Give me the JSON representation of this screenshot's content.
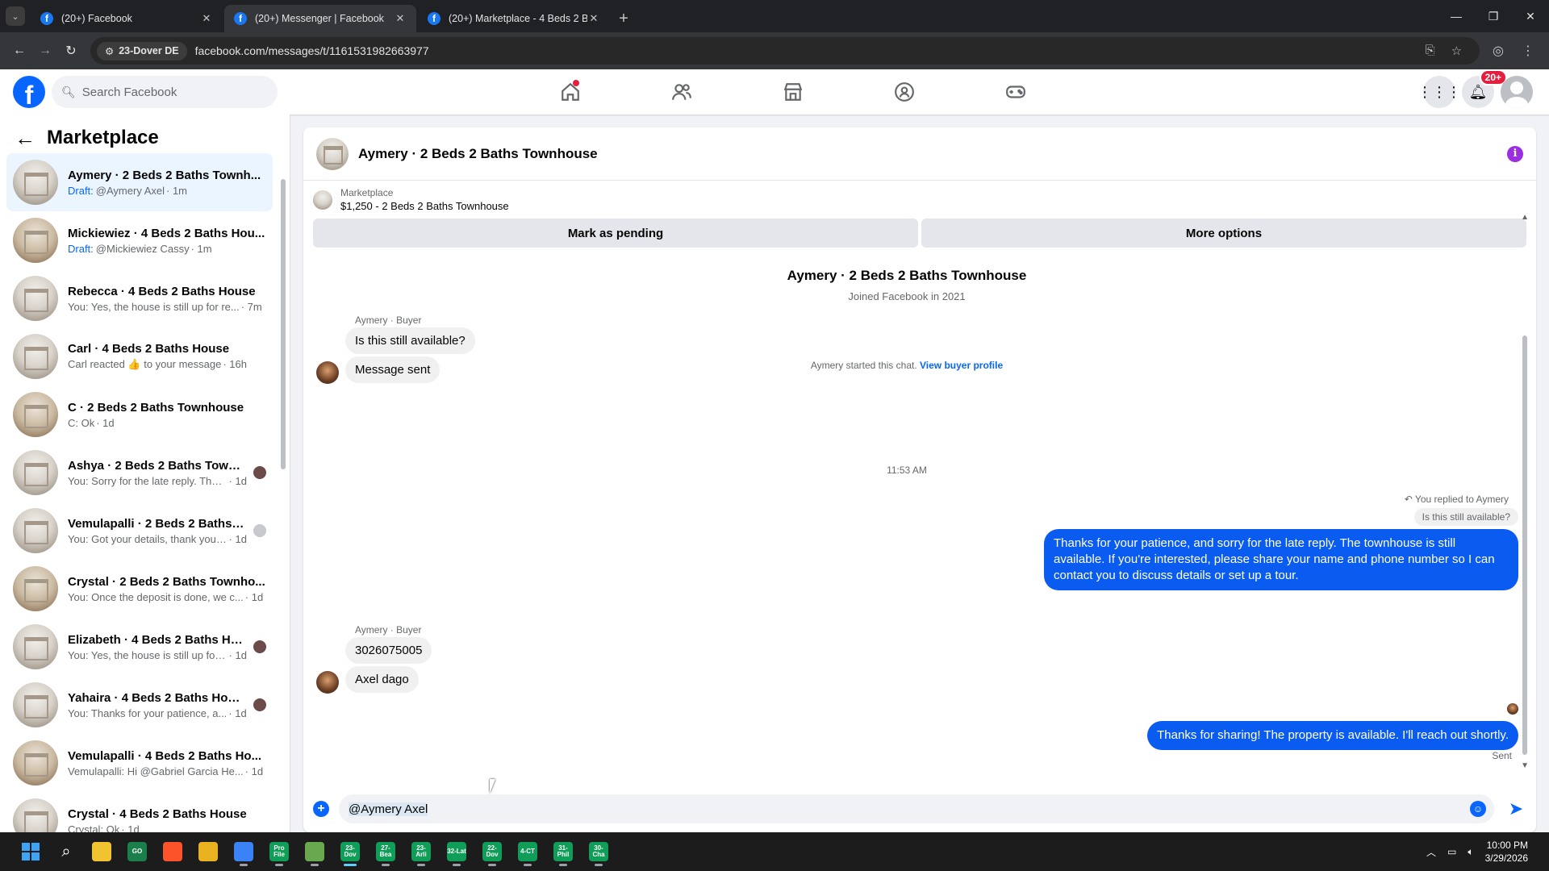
{
  "browser": {
    "tabs": [
      {
        "title": "(20+) Facebook",
        "active": false
      },
      {
        "title": "(20+) Messenger | Facebook",
        "active": true
      },
      {
        "title": "(20+) Marketplace - 4 Beds 2 B",
        "active": false
      }
    ],
    "site_chip": "23-Dover DE",
    "url": "facebook.com/messages/t/1161531982663977"
  },
  "header": {
    "search_placeholder": "Search Facebook",
    "notification_badge": "20+"
  },
  "sidebar": {
    "title": "Marketplace",
    "conversations": [
      {
        "name": "Aymery · 2 Beds 2 Baths Townh...",
        "draft": "Draft:",
        "preview": "@Aymery Axel",
        "time": "· 1m",
        "active": true,
        "seen": ""
      },
      {
        "name": "Mickiewiez · 4 Beds 2 Baths Hou...",
        "draft": "Draft:",
        "preview": "@Mickiewiez Cassy",
        "time": "· 1m",
        "active": false,
        "seen": ""
      },
      {
        "name": "Rebecca · 4 Beds 2 Baths House",
        "draft": "",
        "preview": "You: Yes, the house is still up for re...",
        "time": " · 7m",
        "active": false,
        "seen": ""
      },
      {
        "name": "Carl · 4 Beds 2 Baths House",
        "draft": "",
        "preview": "Carl reacted 👍 to your message",
        "time": " · 16h",
        "active": false,
        "seen": ""
      },
      {
        "name": "C · 2 Beds 2 Baths Townhouse",
        "draft": "",
        "preview": "C: Ok",
        "time": " · 1d",
        "active": false,
        "seen": ""
      },
      {
        "name": "Ashya · 2 Beds 2 Baths Townh...",
        "draft": "",
        "preview": "You: Sorry for the late reply. The ...",
        "time": " · 1d",
        "active": false,
        "seen": "dark"
      },
      {
        "name": "Vemulapalli · 2 Beds 2 Baths T...",
        "draft": "",
        "preview": "You: Got your details, thank you!...",
        "time": " · 1d",
        "active": false,
        "seen": "gray"
      },
      {
        "name": "Crystal · 2 Beds 2 Baths Townho...",
        "draft": "",
        "preview": "You: Once the deposit is done, we c...",
        "time": " · 1d",
        "active": false,
        "seen": ""
      },
      {
        "name": "Elizabeth · 4 Beds 2 Baths Ho...",
        "draft": "",
        "preview": "You: Yes, the house is still up for ...",
        "time": " · 1d",
        "active": false,
        "seen": "dark"
      },
      {
        "name": "Yahaira · 4 Beds 2 Baths House",
        "draft": "",
        "preview": "You: Thanks for your patience, a...",
        "time": " · 1d",
        "active": false,
        "seen": "dark"
      },
      {
        "name": "Vemulapalli · 4 Beds 2 Baths Ho...",
        "draft": "",
        "preview": "Vemulapalli: Hi @Gabriel Garcia He...",
        "time": " · 1d",
        "active": false,
        "seen": ""
      },
      {
        "name": "Crystal · 4 Beds 2 Baths House",
        "draft": "",
        "preview": "Crystal: Ok",
        "time": " · 1d",
        "active": false,
        "seen": ""
      }
    ]
  },
  "chat": {
    "title": "Aymery · 2 Beds 2 Baths Townhouse",
    "listing_label": "Marketplace",
    "listing_price": "$1,250 - 2 Beds 2 Baths Townhouse",
    "mark_pending": "Mark as pending",
    "more_options": "More options",
    "profile_name": "Aymery · 2 Beds 2 Baths Townhouse",
    "joined": "Joined Facebook in 2021",
    "started_text": "Aymery started this chat. ",
    "view_profile": "View buyer profile",
    "sender_label_1": "Aymery · Buyer",
    "msg_in_1": "Is this still available?",
    "msg_in_2": "Message sent",
    "timestamp": "11:53 AM",
    "reply_context": "You replied to Aymery",
    "reply_quote": "Is this still available?",
    "msg_out_1": "Thanks for your patience, and sorry for the late reply. The townhouse is still available. If you're interested, please share your name and phone number so I can contact you to discuss details or set up a tour.",
    "sender_label_2": "Aymery · Buyer",
    "msg_in_3": "3026075005",
    "msg_in_4": "Axel dago",
    "msg_out_2": "Thanks for sharing! The property is available. I'll reach out shortly.",
    "sent_label": "Sent",
    "composer_value": "@Aymery Axel"
  },
  "taskbar": {
    "apps": [
      {
        "label": "GO",
        "color": "#1a7f4a"
      },
      {
        "label": "",
        "color": "#fb542b"
      },
      {
        "label": "",
        "color": "#e8b21e"
      },
      {
        "label": "",
        "color": "#3b82f6"
      },
      {
        "label": "Pro File",
        "color": "#0f9d58"
      },
      {
        "label": "",
        "color": "#6aa84f"
      },
      {
        "label": "23-Dov",
        "color": "#0f9d58"
      },
      {
        "label": "27-Bea",
        "color": "#0f9d58"
      },
      {
        "label": "23-Arli",
        "color": "#0f9d58"
      },
      {
        "label": "32-Lat",
        "color": "#0f9d58"
      },
      {
        "label": "22-Dov",
        "color": "#0f9d58"
      },
      {
        "label": "4-CT",
        "color": "#0f9d58"
      },
      {
        "label": "31-Phil",
        "color": "#0f9d58"
      },
      {
        "label": "30-Cha",
        "color": "#0f9d58"
      }
    ],
    "time": "10:00 PM",
    "date": "3/29/2026"
  }
}
